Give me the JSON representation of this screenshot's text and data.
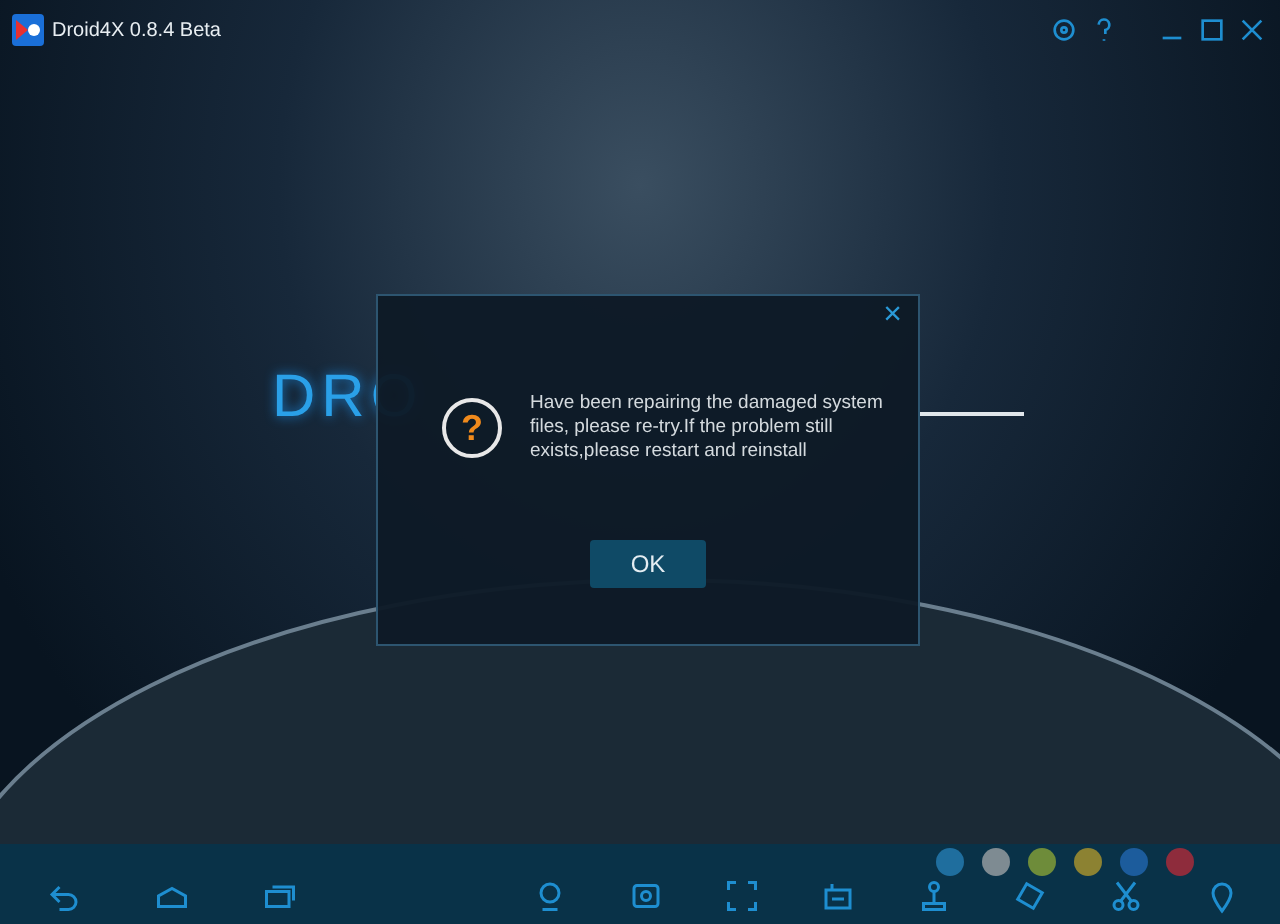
{
  "window": {
    "title": "Droid4X 0.8.4 Beta"
  },
  "splash": {
    "logo_text": "DRO"
  },
  "dialog": {
    "close": "×",
    "icon": "?",
    "message": "Have been repairing the damaged system files, please re-try.If the problem still exists,please restart and reinstall",
    "button": "OK"
  },
  "color_dots": [
    {
      "color": "#1f6e9e"
    },
    {
      "color": "#7e8b92"
    },
    {
      "color": "#6e8c3a"
    },
    {
      "color": "#8c8232"
    },
    {
      "color": "#1c5c9c"
    },
    {
      "color": "#8e2c3c"
    }
  ]
}
